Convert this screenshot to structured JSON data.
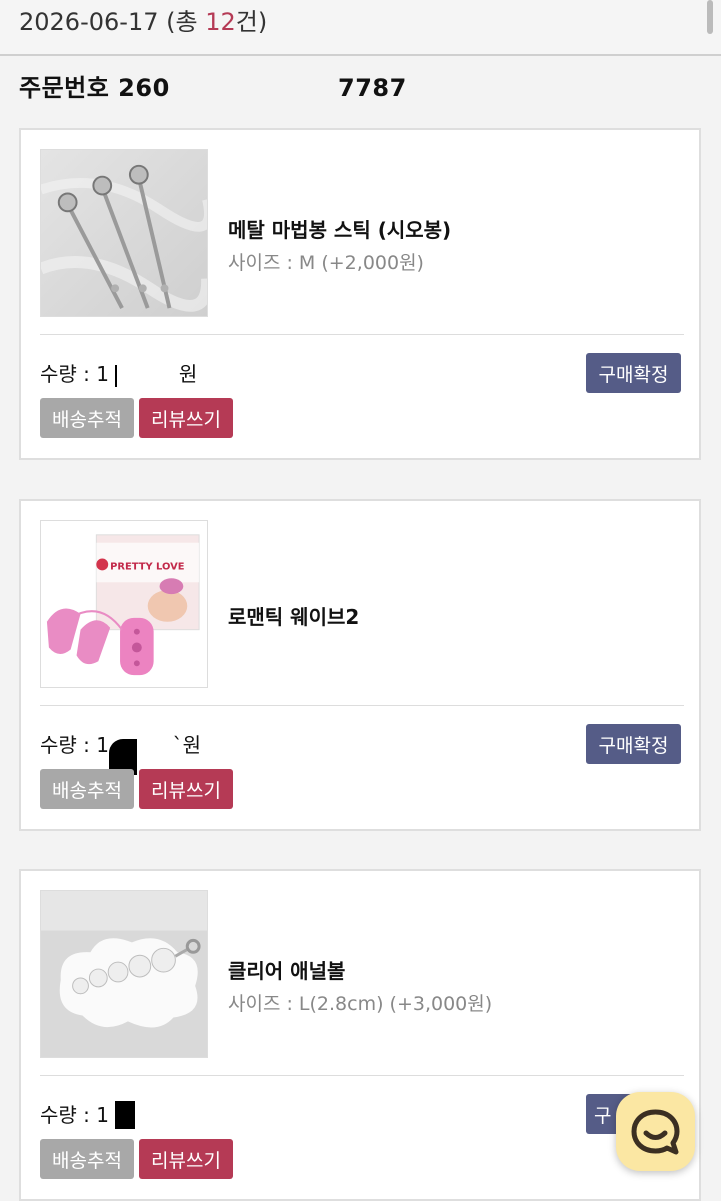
{
  "header": {
    "date": "2026-06-17",
    "count_prefix": " (총 ",
    "count": "12",
    "count_suffix": "건)"
  },
  "order": {
    "number_text": "주문번호 260                   7787"
  },
  "items": [
    {
      "name": "메탈 마법봉 스틱 (시오봉)",
      "option": "사이즈 : M (+2,000원)",
      "quantity": "수량 : 1",
      "price_tail": "원",
      "image": "metal-wand-image",
      "confirm_label": "구매확정",
      "track_label": "배송추적",
      "review_label": "리뷰쓰기"
    },
    {
      "name": "로맨틱 웨이브2",
      "option": "",
      "quantity": "수량 : 1",
      "price_tail": "`원",
      "image": "pretty-love-product-image",
      "confirm_label": "구매확정",
      "track_label": "배송추적",
      "review_label": "리뷰쓰기"
    },
    {
      "name": "클리어 애널볼",
      "option": "사이즈 : L(2.8cm) (+3,000원)",
      "quantity": "수량 : 1",
      "price_tail": "",
      "image": "clear-bead-image",
      "confirm_label": "구",
      "track_label": "배송추적",
      "review_label": "리뷰쓰기"
    }
  ],
  "logo_text": "PRETTY LOVE",
  "chat": {
    "icon": "chat-bubble-icon"
  },
  "colors": {
    "accent": "#b53a55",
    "confirm_button": "#555c87",
    "track_button": "#a8a8a8",
    "chat_button": "#fbe7a3"
  }
}
